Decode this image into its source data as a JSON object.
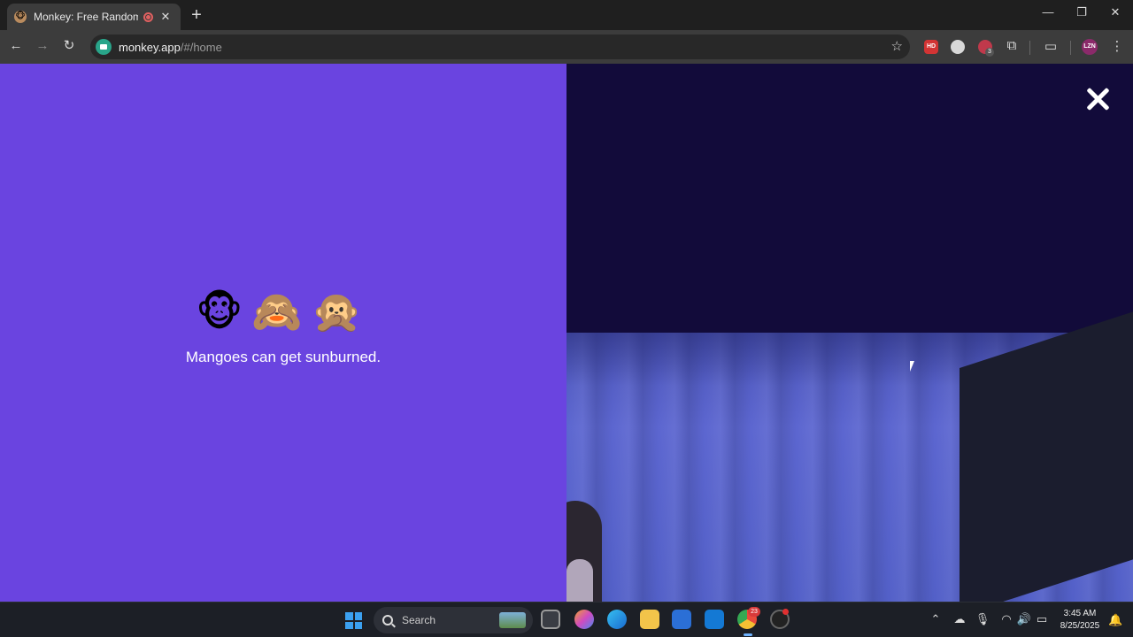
{
  "browser": {
    "tab": {
      "title": "Monkey: Free Random Video Chat",
      "close": "✕"
    },
    "new_tab": "+",
    "window": {
      "minimize": "—",
      "restore": "❐",
      "close": "✕"
    },
    "nav": {
      "back": "←",
      "forward": "→",
      "reload": "↻"
    },
    "address": {
      "host": "monkey.app",
      "path": "/#/home"
    },
    "extensions": {
      "hd_label": "HD",
      "badge_count": "3",
      "profile_initials": "LZN"
    }
  },
  "page": {
    "emoji": [
      "🐵",
      "🙈",
      "🙊"
    ],
    "fact": "Mangoes can get sunburned."
  },
  "taskbar": {
    "search_placeholder": "Search",
    "chrome_badge": "23",
    "time": "3:45 AM",
    "date": "8/25/2025"
  },
  "colors": {
    "left_pane": "#6a44e0",
    "right_pane": "#120b3a",
    "site_icon": "#29a58a"
  }
}
